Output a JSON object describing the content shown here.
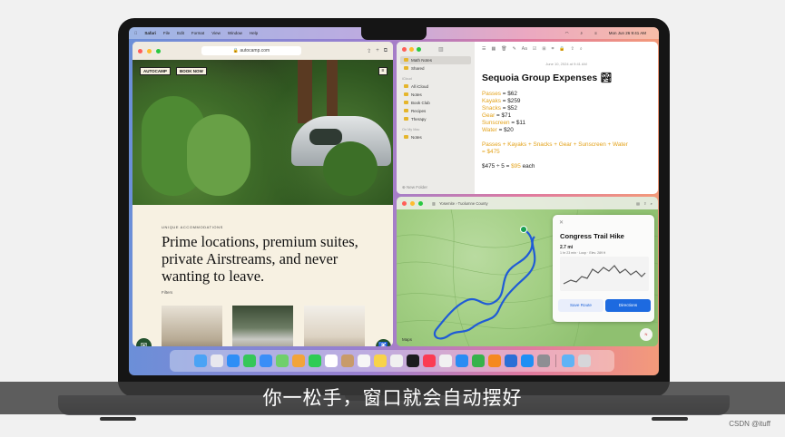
{
  "menubar": {
    "app": "Safari",
    "items": [
      "File",
      "Edit",
      "Format",
      "View",
      "Window",
      "Help"
    ],
    "clock": "Mon Jun 26  9:41 AM"
  },
  "safari": {
    "url": "autocamp.com",
    "logo": "AUTOCAMP",
    "book_button": "BOOK NOW",
    "eyebrow": "UNIQUE ACCOMMODATIONS",
    "headline": "Prime locations, premium suites, private Airstreams, and never wanting to leave.",
    "filter_label": "Filters"
  },
  "notes": {
    "folders": [
      {
        "label": "Math Notes",
        "selected": true
      },
      {
        "label": "Shared",
        "selected": false
      }
    ],
    "icloud_caption": "iCloud",
    "icloud_folders": [
      "All iCloud",
      "Notes",
      "Book Club",
      "Recipes",
      "Therapy"
    ],
    "onmymac_caption": "On My Mac",
    "mac_folders": [
      "Notes"
    ],
    "new_folder": "New Folder",
    "date": "June 10, 2024 at 9:41 AM",
    "title": "Sequoia Group Expenses 🏞",
    "lines": [
      {
        "label": "Passes",
        "value": "= $62"
      },
      {
        "label": "Kayaks",
        "value": "= $259"
      },
      {
        "label": "Snacks",
        "value": "= $52"
      },
      {
        "label": "Gear",
        "value": "= $71"
      },
      {
        "label": "Sunscreen",
        "value": "= $11"
      },
      {
        "label": "Water",
        "value": "= $20"
      }
    ],
    "sum_line_a": "Passes + Kayaks + Snacks + Gear + Sunscreen + Water",
    "sum_line_b": "= $475",
    "each_line_prefix": "$475 ÷ 5 = ",
    "each_value": "$95",
    "each_suffix": " each"
  },
  "maps": {
    "toolbar_label": "Yosemite  ›  Tuolumne County",
    "card_title": "Congress Trail Hike",
    "distance": "2.7 mi",
    "meta": "1 hr 23 min   ·   Loop   ·   Elev. 289 ft",
    "save_button": "Save Route",
    "directions_button": "Directions",
    "logo": " Maps",
    "compass": "N"
  },
  "subtitle": "你一松手，窗口就会自动摆好",
  "watermark": "CSDN @ituff",
  "colors": {
    "notes_accent": "#e3a21a",
    "safari_green": "#23512d",
    "maps_blue": "#1d6ae0",
    "route_blue": "#1f5bd6"
  },
  "dock": {
    "icons": [
      {
        "name": "finder-icon",
        "color": "#4aa3f5"
      },
      {
        "name": "launchpad-icon",
        "color": "#e8e8ee"
      },
      {
        "name": "safari-icon",
        "color": "#2f8ef6"
      },
      {
        "name": "messages-icon",
        "color": "#35c759"
      },
      {
        "name": "mail-icon",
        "color": "#3a8ef7"
      },
      {
        "name": "maps-icon",
        "color": "#6fcf6b"
      },
      {
        "name": "photos-icon",
        "color": "#f2a43a"
      },
      {
        "name": "facetime-icon",
        "color": "#2ecc55"
      },
      {
        "name": "calendar-icon",
        "color": "#ffffff"
      },
      {
        "name": "contacts-icon",
        "color": "#c89b6a"
      },
      {
        "name": "reminders-icon",
        "color": "#f6f6f6"
      },
      {
        "name": "notes-icon",
        "color": "#f8d34a"
      },
      {
        "name": "freeform-icon",
        "color": "#f0f0f0"
      },
      {
        "name": "tv-icon",
        "color": "#1c1c1e"
      },
      {
        "name": "music-icon",
        "color": "#fb3c53"
      },
      {
        "name": "news-icon",
        "color": "#f1f1f1"
      },
      {
        "name": "keynote-icon",
        "color": "#2a8cf3"
      },
      {
        "name": "numbers-icon",
        "color": "#36b24a"
      },
      {
        "name": "pages-icon",
        "color": "#f5891f"
      },
      {
        "name": "xcode-icon",
        "color": "#2b6fd6"
      },
      {
        "name": "app-store-icon",
        "color": "#1f8ff4"
      },
      {
        "name": "system-settings-icon",
        "color": "#8e8e93"
      }
    ],
    "trailing": [
      {
        "name": "downloads-folder-icon",
        "color": "#5fb3f5"
      },
      {
        "name": "trash-icon",
        "color": "#d6d6da"
      }
    ]
  }
}
